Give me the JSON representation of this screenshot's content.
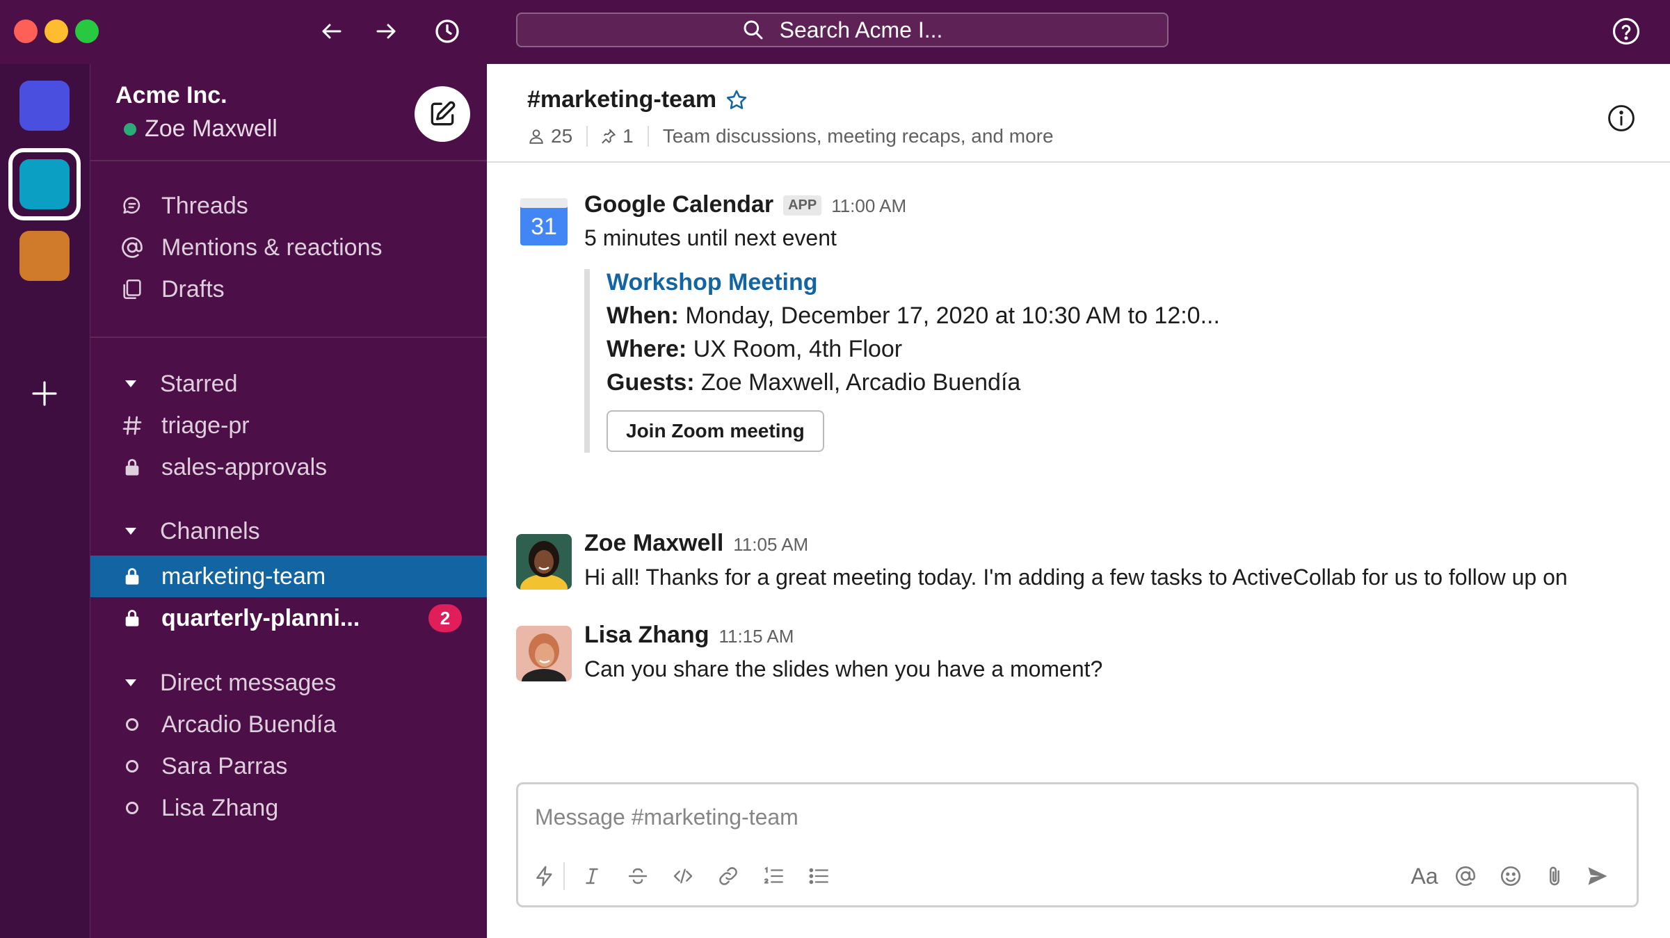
{
  "titlebar": {
    "search_placeholder": "Search Acme I..."
  },
  "workspaces": [
    {
      "color": "#4a4fe0"
    },
    {
      "color": "#0b9fc4",
      "selected": true
    },
    {
      "color": "#d07a2b"
    }
  ],
  "sidebar": {
    "workspace_name": "Acme Inc.",
    "user_name": "Zoe Maxwell",
    "nav": [
      {
        "label": "Threads",
        "icon": "threads-icon"
      },
      {
        "label": "Mentions & reactions",
        "icon": "at-icon"
      },
      {
        "label": "Drafts",
        "icon": "drafts-icon"
      }
    ],
    "starred": {
      "label": "Starred",
      "items": [
        {
          "label": "triage-pr",
          "icon": "hash-icon"
        },
        {
          "label": "sales-approvals",
          "icon": "lock-icon"
        }
      ]
    },
    "channels": {
      "label": "Channels",
      "items": [
        {
          "label": "marketing-team",
          "icon": "lock-icon",
          "active": true
        },
        {
          "label": "quarterly-planni...",
          "icon": "lock-icon",
          "unread": true,
          "badge": "2"
        }
      ]
    },
    "direct_messages": {
      "label": "Direct messages",
      "items": [
        {
          "label": "Arcadio Buendía"
        },
        {
          "label": "Sara Parras"
        },
        {
          "label": "Lisa Zhang"
        }
      ]
    }
  },
  "channel": {
    "name": "#marketing-team",
    "members": "25",
    "pins": "1",
    "topic": "Team discussions, meeting recaps, and more"
  },
  "messages": [
    {
      "sender": "Google Calendar",
      "tag": "APP",
      "time": "11:00 AM",
      "text": "5 minutes until next event",
      "calendar_day": "31",
      "attachment": {
        "title": "Workshop Meeting",
        "when_label": "When:",
        "when": "Monday, December 17, 2020 at 10:30 AM to 12:0...",
        "where_label": "Where:",
        "where": "UX Room, 4th Floor",
        "guests_label": "Guests:",
        "guests": "Zoe Maxwell, Arcadio Buendía",
        "button": "Join Zoom meeting"
      }
    },
    {
      "sender": "Zoe Maxwell",
      "time": "11:05 AM",
      "text": "Hi all! Thanks for a great meeting today. I'm adding a few tasks to ActiveCollab for us to follow up on"
    },
    {
      "sender": "Lisa Zhang",
      "time": "11:15 AM",
      "text": "Can you share the slides when you have a moment?"
    }
  ],
  "composer": {
    "placeholder": "Message #marketing-team",
    "format_label": "Aa"
  },
  "colors": {
    "titlebar": "#4d0f47",
    "sidebar": "#4d0f47",
    "rail": "#3f0e40",
    "active_item": "#1264a3",
    "badge": "#e01e5a",
    "link": "#1264a3",
    "online": "#2bac76"
  }
}
